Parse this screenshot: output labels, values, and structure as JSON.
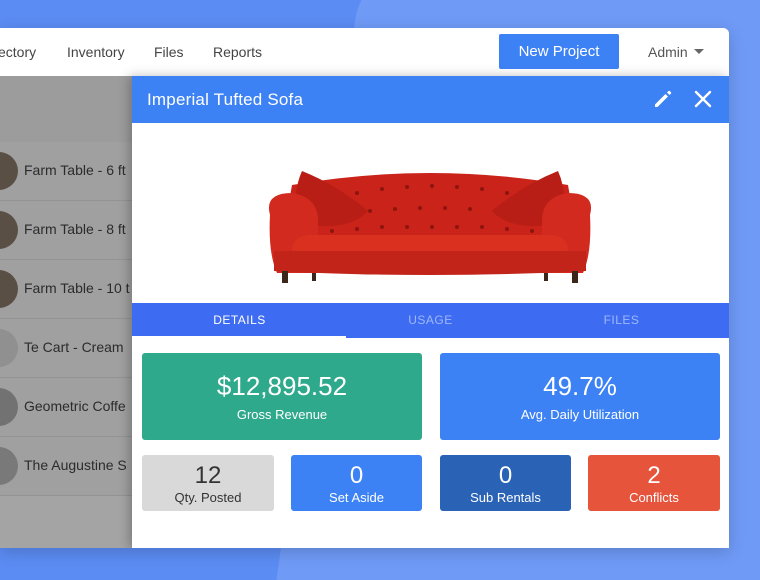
{
  "colors": {
    "primary": "#3d82f5",
    "green": "#2fa98c",
    "blue": "#3d82f5",
    "gray": "#d9d9d9",
    "darkblue": "#2a63b5",
    "red": "#e6543b"
  },
  "topbar": {
    "nav": [
      "ectory",
      "Inventory",
      "Files",
      "Reports"
    ],
    "new_project": "New Project",
    "admin": "Admin"
  },
  "list": {
    "rows": [
      "Farm Table - 6 ft",
      "Farm Table - 8 ft",
      "Farm Table - 10 t",
      "Te Cart - Cream",
      "Geometric Coffe",
      "The Augustine S"
    ]
  },
  "panel": {
    "title": "Imperial Tufted Sofa",
    "tabs": [
      "DETAILS",
      "USAGE",
      "FILES"
    ],
    "active_tab": "DETAILS",
    "stats": {
      "gross_revenue": {
        "value": "$12,895.52",
        "label": "Gross Revenue"
      },
      "utilization": {
        "value": "49.7%",
        "label": "Avg. Daily Utilization"
      },
      "qty_posted": {
        "value": "12",
        "label": "Qty. Posted"
      },
      "set_aside": {
        "value": "0",
        "label": "Set Aside"
      },
      "sub_rentals": {
        "value": "0",
        "label": "Sub Rentals"
      },
      "conflicts": {
        "value": "2",
        "label": "Conflicts"
      }
    }
  }
}
